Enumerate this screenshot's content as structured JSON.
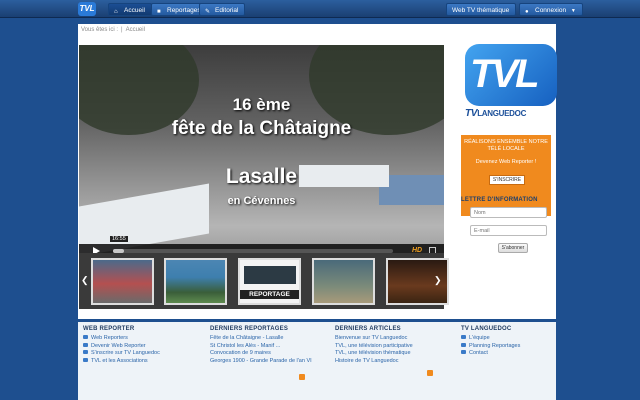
{
  "nav": {
    "logo": "TVL",
    "items": [
      {
        "label": "Accueil",
        "icon": "home-icon"
      },
      {
        "label": "Reportages",
        "icon": "camera-icon"
      },
      {
        "label": "Editorial",
        "icon": "edit-icon"
      }
    ],
    "right": [
      {
        "label": "Web TV thématique"
      },
      {
        "label": "Connexion",
        "icon": "user-icon"
      }
    ]
  },
  "breadcrumb": {
    "prefix": "Vous êtes ici :",
    "current": "Accueil"
  },
  "video": {
    "line1": "16 ème",
    "line2": "fête de la Châtaigne",
    "line3": "Lasalle",
    "line4": "en Cévennes",
    "timecode": "16:55",
    "hd": "HD",
    "progress": 0.04
  },
  "thumbs": {
    "items": [
      {
        "label": ""
      },
      {
        "label": ""
      },
      {
        "label": "REPORTAGE"
      },
      {
        "label": ""
      },
      {
        "label": ""
      }
    ]
  },
  "sidebar": {
    "logo_big": "TVL",
    "logo_sub_tv": "TV",
    "logo_sub_name": "LANGUEDOC",
    "promo_text": "RÉALISONS ENSEMBLE NOTRE TÉLÉ LOCALE",
    "promo_sub": "Devenez Web Reporter !",
    "promo_button": "S'INSCRIRE",
    "newsletter_title": "LETTRE D'INFORMATION",
    "nom_placeholder": "Nom",
    "email_placeholder": "E-mail",
    "subscribe": "S'abonner"
  },
  "footer": {
    "col1": {
      "title": "WEB REPORTER",
      "links": [
        "Web Reporters",
        "Devenir Web Reporter",
        "S'inscrire sur TV Languedoc",
        "TVL et les Associations"
      ]
    },
    "col2": {
      "title": "DERNIERS REPORTAGES",
      "links": [
        "Fête de la Châtaigne - Lasalle",
        "St Christol les Alès - Manif ...",
        "Convocation de 9 maires",
        "Georges 1900 - Grande Parade de l'an VI"
      ]
    },
    "col3": {
      "title": "DERNIERS ARTICLES",
      "links": [
        "Bienvenue sur TV Languedoc",
        "TVL, une télévision participative",
        "TVL, une télévision thématique",
        "Histoire de TV Languedoc"
      ]
    },
    "col4": {
      "title": "TV LANGUEDOC",
      "links": [
        "L'équipe",
        "Planning Reportages",
        "Contact"
      ]
    }
  },
  "colors": {
    "accent": "#2a7ad8",
    "promo": "#f08a1e",
    "nav": "#1a3f72"
  }
}
